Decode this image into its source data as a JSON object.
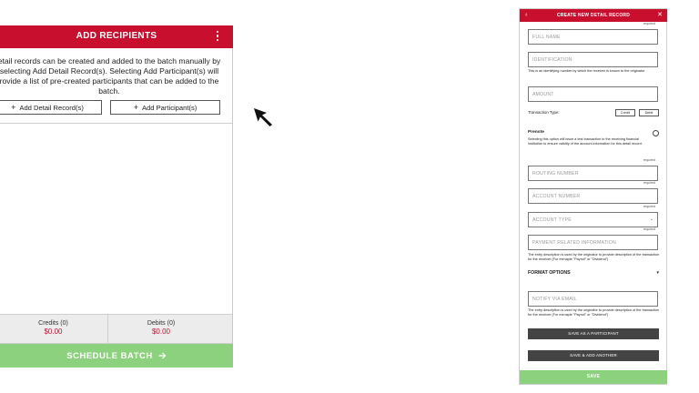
{
  "left": {
    "title": "ADD RECIPIENTS",
    "description": "etail records can be created and added to the batch manually by selecting Add Detail Record(s). Selecting Add Participant(s) will rovide a list of pre-created participants that can be added to the batch.",
    "add_detail_label": "Add Detail Record(s)",
    "add_participant_label": "Add Participant(s)",
    "credits_label": "Credits (0)",
    "credits_amount": "$0.00",
    "debits_label": "Debits (0)",
    "debits_amount": "$0.00",
    "schedule_label": "SCHEDULE BATCH"
  },
  "right": {
    "title": "CREATE NEW DETAIL RECORD",
    "required_text": "required",
    "full_name_placeholder": "FULL NAME",
    "identification_placeholder": "IDENTIFICATION",
    "identification_note": "This is an identifying number by which the receiver is known to the originator",
    "amount_placeholder": "AMOUNT",
    "transaction_type_label": "Transaction Type:",
    "credit_label": "Credit",
    "debit_label": "Debit",
    "prenote_label": "Prenote",
    "prenote_note": "Selecting this option will issue a test transaction to the receiving financial institution to ensure validity of the account information for this detail record.",
    "routing_placeholder": "ROUTING NUMBER",
    "account_number_placeholder": "ACCOUNT NUMBER",
    "account_type_placeholder": "ACCOUNT TYPE",
    "payment_info_placeholder": "PAYMENT RELATED INFORMATION",
    "payment_note": "The entry description is used by the originator to provide description of the transaction for the receiver (For exmaple \"Payroll\" or \"Dividend\")",
    "format_options_label": "FORMAT OPTIONS",
    "notify_placeholder": "NOTIFY VIA EMAIL",
    "notify_note": "The entry description is used by the originator to provide description of the transaction for the receiver (For exmaple \"Payroll\" or \"Dividend\")",
    "save_participant_label": "SAVE AS A PARTICIPANT",
    "save_add_another_label": "SAVE & ADD ANOTHER",
    "save_label": "SAVE"
  },
  "colors": {
    "brand_red": "#c8102e",
    "save_green": "#8cd17d",
    "dark_button": "#444444"
  },
  "icons": [
    "kebab-menu-icon",
    "plus-icon",
    "arrow-right-icon",
    "back-chevron-icon",
    "close-icon",
    "chevron-down-icon",
    "caret-down-icon",
    "mouse-cursor-icon"
  ]
}
